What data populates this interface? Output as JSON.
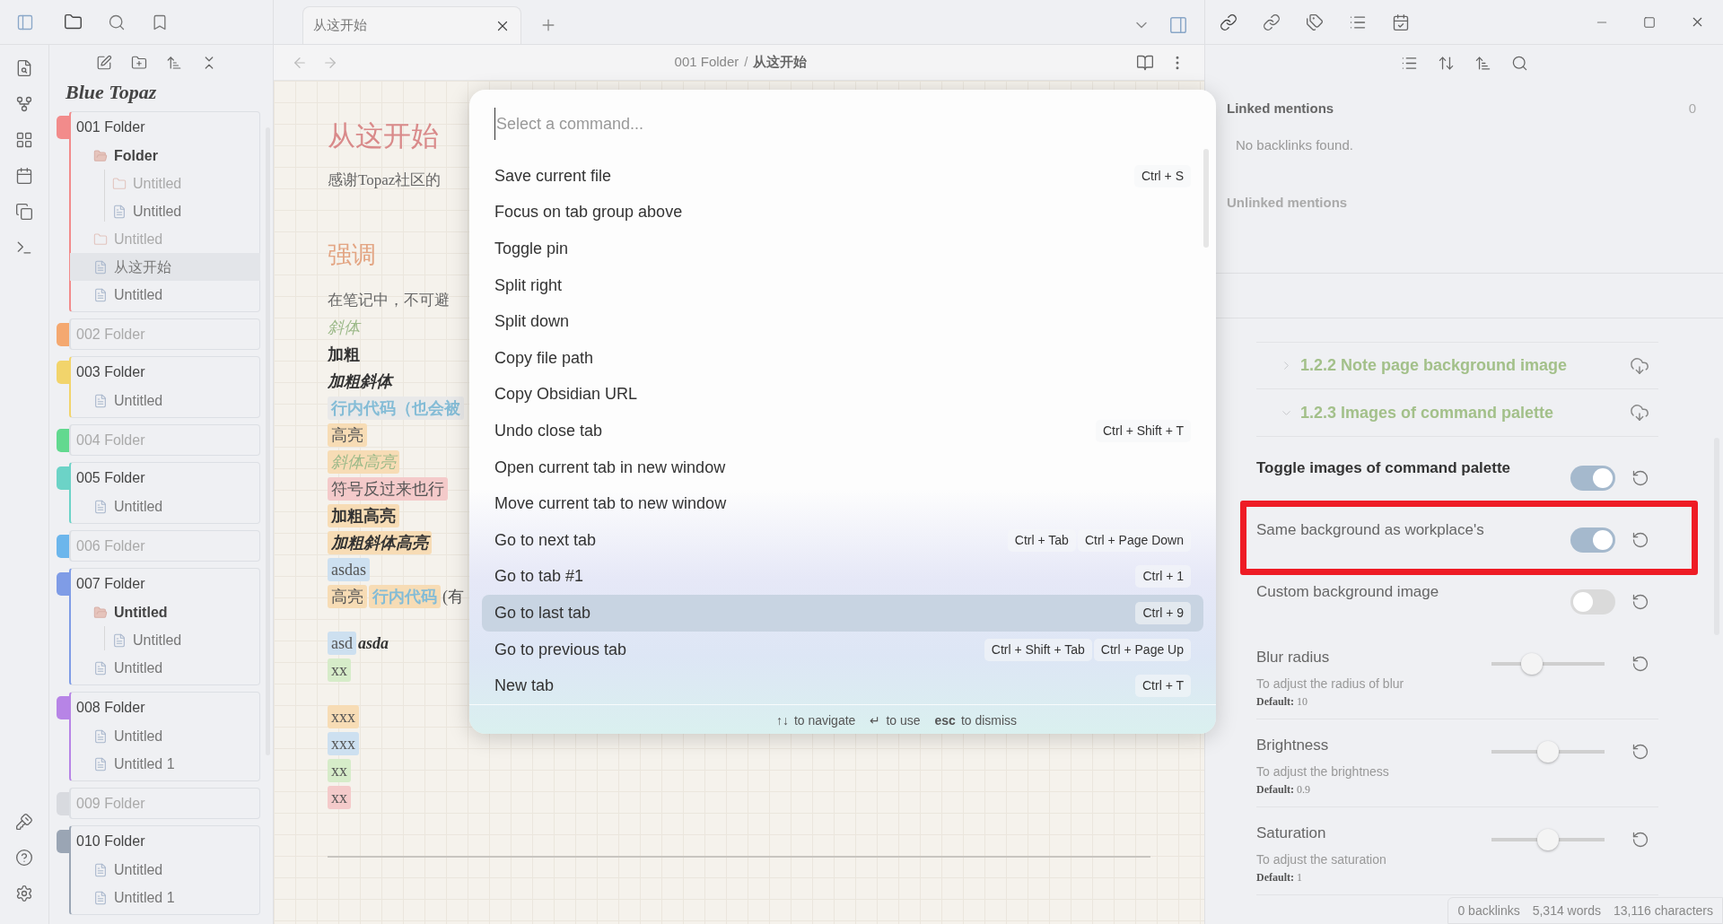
{
  "tabs": [
    {
      "title": "从这开始",
      "selected": true
    }
  ],
  "sidebar": {
    "logo": "Blue Topaz",
    "folders": [
      {
        "name": "001 Folder",
        "color": "#f28b8b",
        "expanded": true,
        "selected": false,
        "children": [
          {
            "kind": "folder",
            "name": "Folder",
            "expanded": true,
            "selected": false,
            "children": [
              {
                "kind": "folder",
                "name": "Untitled",
                "expanded": false,
                "selected": false
              },
              {
                "kind": "file",
                "name": "Untitled",
                "selected": false
              }
            ]
          },
          {
            "kind": "folder",
            "name": "Untitled",
            "expanded": false,
            "selected": false
          },
          {
            "kind": "file",
            "name": "从这开始",
            "selected": true
          },
          {
            "kind": "file",
            "name": "Untitled",
            "selected": false
          }
        ]
      },
      {
        "name": "002 Folder",
        "color": "#f4a870",
        "expanded": false,
        "selected": false
      },
      {
        "name": "003 Folder",
        "color": "#f2d46b",
        "expanded": true,
        "selected": false,
        "children": [
          {
            "kind": "file",
            "name": "Untitled",
            "selected": false
          }
        ]
      },
      {
        "name": "004 Folder",
        "color": "#62d98f",
        "expanded": false,
        "selected": false
      },
      {
        "name": "005 Folder",
        "color": "#6cd3c7",
        "expanded": true,
        "selected": false,
        "children": [
          {
            "kind": "file",
            "name": "Untitled",
            "selected": false
          }
        ]
      },
      {
        "name": "006 Folder",
        "color": "#6cb6ec",
        "expanded": false,
        "selected": false
      },
      {
        "name": "007 Folder",
        "color": "#7f9ce6",
        "expanded": true,
        "selected": false,
        "children": [
          {
            "kind": "folder",
            "name": "Untitled",
            "expanded": true,
            "selected": false,
            "children": [
              {
                "kind": "file",
                "name": "Untitled",
                "selected": false
              }
            ]
          },
          {
            "kind": "file",
            "name": "Untitled",
            "selected": false
          }
        ]
      },
      {
        "name": "008 Folder",
        "color": "#b784e6",
        "expanded": true,
        "selected": false,
        "children": [
          {
            "kind": "file",
            "name": "Untitled",
            "selected": false
          },
          {
            "kind": "file",
            "name": "Untitled 1",
            "selected": false
          }
        ]
      },
      {
        "name": "009 Folder",
        "color": "#d8dadf",
        "expanded": false,
        "selected": false
      },
      {
        "name": "010 Folder",
        "color": "#9aa5b4",
        "expanded": true,
        "selected": false,
        "children": [
          {
            "kind": "file",
            "name": "Untitled",
            "selected": false
          },
          {
            "kind": "file",
            "name": "Untitled 1",
            "selected": false
          }
        ]
      }
    ]
  },
  "breadcrumb": {
    "folder": "001 Folder",
    "separator": "/",
    "note": "从这开始"
  },
  "note": {
    "blocks": [
      {
        "kind": "title",
        "text": "从这开始"
      },
      {
        "kind": "paragraph",
        "text": "感谢Topaz社区的"
      },
      {
        "kind": "heading",
        "text": "强调"
      },
      {
        "kind": "paragraph",
        "text": "在笔记中，不可避"
      },
      {
        "kind": "lines",
        "lines": [
          [
            {
              "text": "斜体",
              "kind": "italic"
            }
          ],
          [
            {
              "text": "加粗",
              "kind": "bold"
            }
          ],
          [
            {
              "text": "加粗斜体",
              "kind": "bold_italic"
            }
          ],
          [
            {
              "text": "行内代码（也会被",
              "kind": "code"
            }
          ],
          [
            {
              "text": "高亮",
              "kind": "plain",
              "color": "#f7dcb5"
            }
          ],
          [
            {
              "text": "斜体高亮",
              "kind": "italic",
              "color": "#f7dcb5"
            }
          ],
          [
            {
              "text": "符号反过来也行",
              "kind": "plain",
              "color": "#f4caca"
            }
          ],
          [
            {
              "text": "加粗高亮",
              "kind": "bold",
              "color": "#f7dcb5"
            }
          ],
          [
            {
              "text": "加粗斜体高亮",
              "kind": "bold_italic",
              "color": "#f7dcb5"
            }
          ],
          [
            {
              "text": "asdas",
              "kind": "plain",
              "color": "#cde0f0"
            }
          ],
          [
            {
              "text": "高亮",
              "kind": "plain",
              "color": "#f7dcb5"
            },
            {
              "text": "行内代码",
              "kind": "code",
              "color": "#f7dcb5"
            },
            {
              "text": "(有",
              "kind": "plain"
            }
          ]
        ]
      },
      {
        "kind": "lines",
        "lines": [
          [
            {
              "text": "asd",
              "kind": "plain",
              "color": "#cde0f0"
            },
            {
              "text": "asda",
              "kind": "bold_italic"
            }
          ],
          [
            {
              "text": "xx",
              "kind": "plain",
              "color": "#d6ecc9"
            }
          ]
        ]
      },
      {
        "kind": "lines",
        "lines": [
          [
            {
              "text": "xxx",
              "kind": "plain",
              "color": "#f7dcb5"
            }
          ],
          [
            {
              "text": "xxx",
              "kind": "plain",
              "color": "#cde0f0"
            }
          ],
          [
            {
              "text": "xx",
              "kind": "plain",
              "color": "#d6ecc9"
            }
          ],
          [
            {
              "text": "xx",
              "kind": "plain",
              "color": "#f4caca"
            }
          ]
        ]
      }
    ]
  },
  "command_palette": {
    "placeholder": "Select a command...",
    "commands": [
      {
        "name": "Save current file",
        "hotkeys": [
          "Ctrl + S"
        ],
        "selected": false
      },
      {
        "name": "Focus on tab group above",
        "selected": false
      },
      {
        "name": "Toggle pin",
        "selected": false
      },
      {
        "name": "Split right",
        "selected": false
      },
      {
        "name": "Split down",
        "selected": false
      },
      {
        "name": "Copy file path",
        "selected": false
      },
      {
        "name": "Copy Obsidian URL",
        "selected": false
      },
      {
        "name": "Undo close tab",
        "hotkeys": [
          "Ctrl + Shift + T"
        ],
        "selected": false
      },
      {
        "name": "Open current tab in new window",
        "selected": false
      },
      {
        "name": "Move current tab to new window",
        "selected": false
      },
      {
        "name": "Go to next tab",
        "hotkeys": [
          "Ctrl + Tab",
          "Ctrl + Page Down"
        ],
        "selected": false
      },
      {
        "name": "Go to tab #1",
        "hotkeys": [
          "Ctrl + 1"
        ],
        "selected": false
      },
      {
        "name": "Go to last tab",
        "hotkeys": [
          "Ctrl + 9"
        ],
        "selected": true
      },
      {
        "name": "Go to previous tab",
        "hotkeys": [
          "Ctrl + Shift + Tab",
          "Ctrl + Page Up"
        ],
        "selected": false
      },
      {
        "name": "New tab",
        "hotkeys": [
          "Ctrl + T"
        ],
        "selected": false
      }
    ],
    "instructions": [
      {
        "key": "↑↓",
        "label": "to navigate"
      },
      {
        "key": "↵",
        "label": "to use"
      },
      {
        "key": "esc",
        "label": "to dismiss"
      }
    ]
  },
  "backlinks": {
    "linked_title": "Linked mentions",
    "linked_count": "0",
    "empty": "No backlinks found.",
    "unlinked_title": "Unlinked mentions"
  },
  "settings": {
    "sections": [
      {
        "title": "1.2.2 Note page background image",
        "expanded": false
      },
      {
        "title": "1.2.3 Images of command palette",
        "expanded": true
      }
    ],
    "options": [
      {
        "kind": "toggle",
        "name": "Toggle images of command palette",
        "bold": true,
        "on": true,
        "highlighted": false
      },
      {
        "kind": "toggle",
        "name": "Same background as workplace's",
        "bold": false,
        "on": true,
        "highlighted": true
      },
      {
        "kind": "toggle",
        "name": "Custom background image",
        "bold": false,
        "on": false,
        "highlighted": false
      },
      {
        "kind": "slider",
        "name": "Blur radius",
        "description": "To adjust the radius of blur",
        "default": "**Default:** 10",
        "level": 0.36,
        "bold": false,
        "highlighted": false
      },
      {
        "kind": "slider",
        "name": "Brightness",
        "description": "To adjust the brightness",
        "default": "**Default:** 0.9",
        "level": 0.5,
        "bold": false,
        "highlighted": false
      },
      {
        "kind": "slider",
        "name": "Saturation",
        "description": "To adjust the saturation",
        "default": "**Default:** 1",
        "level": 0.5,
        "bold": false,
        "highlighted": false
      }
    ]
  },
  "status_bar": [
    "0 backlinks",
    "5,314 words",
    "13,116 characters"
  ]
}
